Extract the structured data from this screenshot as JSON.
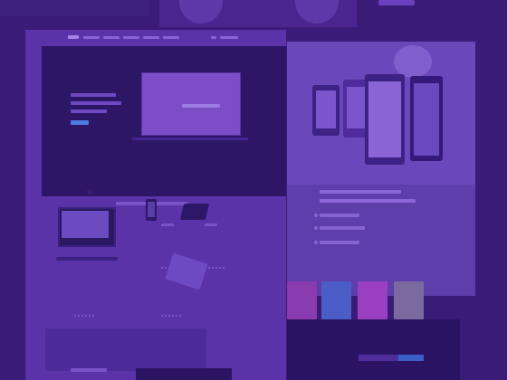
{
  "hero": {
    "title": "",
    "button": ""
  },
  "laptop": {
    "screen_text": ""
  },
  "products": {
    "section_title": "",
    "labels": [
      "",
      "",
      ""
    ]
  },
  "phones_panel": {
    "heading": ""
  },
  "tiles": {
    "colors": [
      "#8b3bb0",
      "#4b5cc7",
      "#9a3fc0",
      "#7a6a9f"
    ]
  },
  "colors": {
    "background": "#3a1c78",
    "hero_dark": "#2e1666",
    "accent_blue": "#4d7be0"
  }
}
